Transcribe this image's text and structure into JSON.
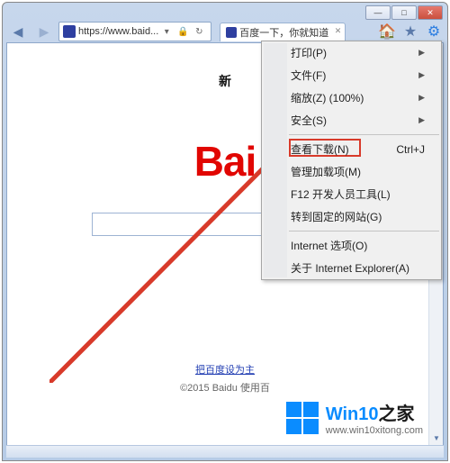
{
  "window": {
    "minimize": "—",
    "maximize": "□",
    "close": "✕"
  },
  "nav": {
    "back": "◀",
    "forward": "▶",
    "url": "https://www.baid...",
    "url_dropdown": "▾",
    "lock": "🔒",
    "refresh": "↻"
  },
  "tab": {
    "title": "百度一下，你就知道",
    "close": "✕"
  },
  "tools": {
    "home": "🏠",
    "fav": "★",
    "gear": "⚙"
  },
  "page": {
    "heading": "新",
    "logo": "Bai",
    "set_home": "把百度设为主",
    "copyright": "©2015 Baidu 使用百"
  },
  "menu": {
    "items": [
      {
        "label": "打印(P)",
        "arrow": true
      },
      {
        "label": "文件(F)",
        "arrow": true
      },
      {
        "label": "缩放(Z) (100%)",
        "arrow": true
      },
      {
        "label": "安全(S)",
        "arrow": true
      }
    ],
    "items2": [
      {
        "label": "查看下载(N)",
        "shortcut": "Ctrl+J"
      },
      {
        "label": "管理加载项(M)"
      },
      {
        "label": "F12 开发人员工具(L)"
      },
      {
        "label": "转到固定的网站(G)"
      }
    ],
    "items3": [
      {
        "label": "Internet 选项(O)"
      },
      {
        "label": "关于 Internet Explorer(A)"
      }
    ]
  },
  "watermark": {
    "brand_a": "Win10",
    "brand_b": "之家",
    "url": "www.win10xitong.com"
  },
  "scroll": {
    "up": "▲",
    "down": "▼"
  }
}
